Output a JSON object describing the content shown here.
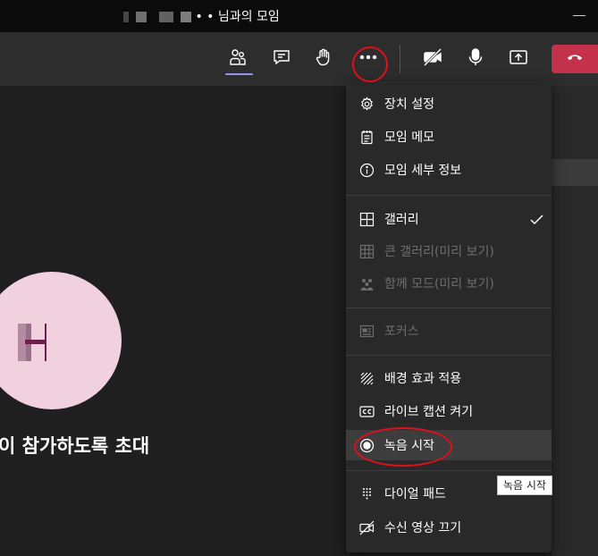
{
  "window": {
    "title_suffix": "님과의 모임",
    "title_dots": "• •"
  },
  "toolbar": {
    "buttons": [
      {
        "name": "participants",
        "icon": "people-icon"
      },
      {
        "name": "chat",
        "icon": "chat-icon"
      },
      {
        "name": "raise-hand",
        "icon": "raise-hand-icon"
      },
      {
        "name": "more-actions",
        "icon": "more-icon"
      },
      {
        "name": "camera-off",
        "icon": "camera-off-icon"
      },
      {
        "name": "mic",
        "icon": "mic-icon"
      },
      {
        "name": "share",
        "icon": "share-tray-icon"
      },
      {
        "name": "leave",
        "icon": "hang-up-icon",
        "color": "#c4314b"
      }
    ]
  },
  "stage": {
    "invite_text": "이 참가하도록 초대",
    "avatar_color": "#f1d1de"
  },
  "menu": {
    "items": [
      {
        "label": "장치 설정",
        "icon": "gear-icon",
        "disabled": false
      },
      {
        "label": "모임 메모",
        "icon": "notes-icon",
        "disabled": false
      },
      {
        "label": "모임 세부 정보",
        "icon": "info-icon",
        "disabled": false
      },
      {
        "label": "갤러리",
        "icon": "grid-icon",
        "disabled": false,
        "checked": true
      },
      {
        "label": "큰 갤러리(미리 보기)",
        "icon": "large-grid-icon",
        "disabled": true
      },
      {
        "label": "함께 모드(미리 보기)",
        "icon": "together-mode-icon",
        "disabled": true
      },
      {
        "label": "포커스",
        "icon": "focus-icon",
        "disabled": true
      },
      {
        "label": "배경 효과 적용",
        "icon": "background-effects-icon",
        "disabled": false
      },
      {
        "label": "라이브 캡션 켜기",
        "icon": "cc-icon",
        "disabled": false
      },
      {
        "label": "녹음 시작",
        "icon": "record-icon",
        "disabled": false,
        "hovered": true
      },
      {
        "label": "다이얼 패드",
        "icon": "dial-pad-icon",
        "disabled": false
      },
      {
        "label": "수신 영상 끄기",
        "icon": "video-off-icon",
        "disabled": false
      }
    ]
  },
  "tooltip": {
    "text": "녹음 시작"
  },
  "colors": {
    "accent": "#8f94e6",
    "annotation": "#e0101a",
    "leave": "#c4314b"
  }
}
